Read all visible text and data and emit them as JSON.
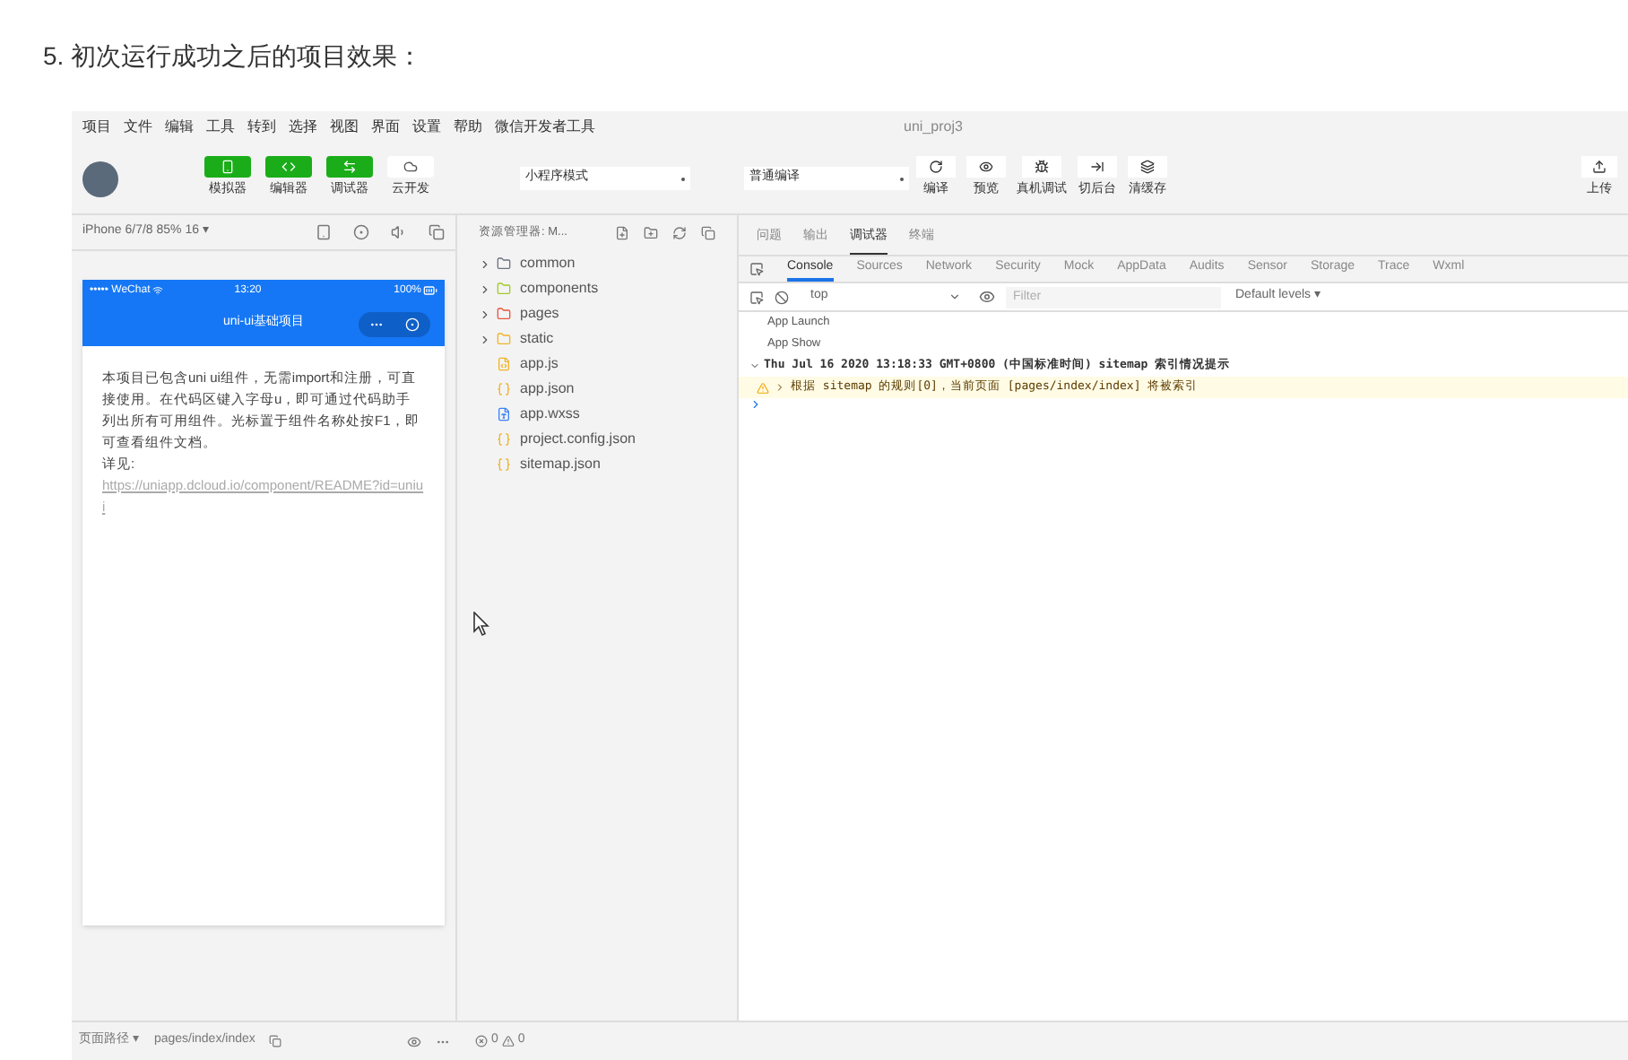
{
  "heading": "5. 初次运行成功之后的项目效果：",
  "menu": [
    "项目",
    "文件",
    "编辑",
    "工具",
    "转到",
    "选择",
    "视图",
    "界面",
    "设置",
    "帮助",
    "微信开发者工具"
  ],
  "window_title": "uni_proj3",
  "view_buttons": [
    {
      "kind": "phone",
      "label": "模拟器",
      "on": true
    },
    {
      "kind": "code",
      "label": "编辑器",
      "on": true
    },
    {
      "kind": "debug",
      "label": "调试器",
      "on": true
    },
    {
      "kind": "cloud",
      "label": "云开发",
      "on": false
    }
  ],
  "mode_select": "小程序模式",
  "compile_select": "普通编译",
  "actions": [
    {
      "kind": "refresh",
      "label": "编译"
    },
    {
      "kind": "eye",
      "label": "预览"
    },
    {
      "kind": "bug",
      "label": "真机调试"
    },
    {
      "kind": "switch",
      "label": "切后台"
    },
    {
      "kind": "layers",
      "label": "清缓存"
    }
  ],
  "upload": "上传",
  "simulator": {
    "device": "iPhone 6/7/8 85% 16 ▾",
    "carrier": "••••• WeChat",
    "time": "13:20",
    "battery": "100%",
    "nav_title": "uni-ui基础项目",
    "body": "本项目已包含uni ui组件，无需import和注册，可直接使用。在代码区键入字母u，即可通过代码助手列出所有可用组件。光标置于组件名称处按F1，即可查看组件文档。",
    "see_label": "详见:",
    "link": "https://uniapp.dcloud.io/component/README?id=uniui"
  },
  "explorer": {
    "title": "资源管理器: M...",
    "items": [
      {
        "kind": "folder",
        "name": "common",
        "color": "#6b7280"
      },
      {
        "kind": "folder",
        "name": "components",
        "color": "#a3c92a"
      },
      {
        "kind": "folder",
        "name": "pages",
        "color": "#e8553e"
      },
      {
        "kind": "folder",
        "name": "static",
        "color": "#f0b429"
      },
      {
        "kind": "js",
        "name": "app.js",
        "color": "#f0b429"
      },
      {
        "kind": "json",
        "name": "app.json",
        "color": "#f0b429"
      },
      {
        "kind": "css",
        "name": "app.wxss",
        "color": "#3b82f6"
      },
      {
        "kind": "json",
        "name": "project.config.json",
        "color": "#f0b429"
      },
      {
        "kind": "json",
        "name": "sitemap.json",
        "color": "#f0b429"
      }
    ]
  },
  "panel_tabs": [
    {
      "label": "问题",
      "selected": false
    },
    {
      "label": "输出",
      "selected": false
    },
    {
      "label": "调试器",
      "selected": true
    },
    {
      "label": "终端",
      "selected": false
    }
  ],
  "devtools_tabs": [
    {
      "label": "Console",
      "selected": true
    },
    {
      "label": "Sources",
      "selected": false
    },
    {
      "label": "Network",
      "selected": false
    },
    {
      "label": "Security",
      "selected": false
    },
    {
      "label": "Mock",
      "selected": false
    },
    {
      "label": "AppData",
      "selected": false
    },
    {
      "label": "Audits",
      "selected": false
    },
    {
      "label": "Sensor",
      "selected": false
    },
    {
      "label": "Storage",
      "selected": false
    },
    {
      "label": "Trace",
      "selected": false
    },
    {
      "label": "Wxml",
      "selected": false
    }
  ],
  "console": {
    "context": "top",
    "filter_placeholder": "Filter",
    "levels": "Default levels ▾",
    "logs": [
      {
        "kind": "log",
        "text": "App Launch"
      },
      {
        "kind": "log",
        "text": "App Show"
      },
      {
        "kind": "group",
        "text": "Thu Jul 16 2020 13:18:33 GMT+0800 (中国标准时间) sitemap 索引情况提示"
      },
      {
        "kind": "warning",
        "text": "根据 sitemap 的规则[0]，当前页面 [pages/index/index] 将被索引"
      }
    ]
  },
  "status": {
    "path_label": "页面路径 ▾",
    "path": "pages/index/index",
    "errors": "0",
    "warnings": "0"
  }
}
